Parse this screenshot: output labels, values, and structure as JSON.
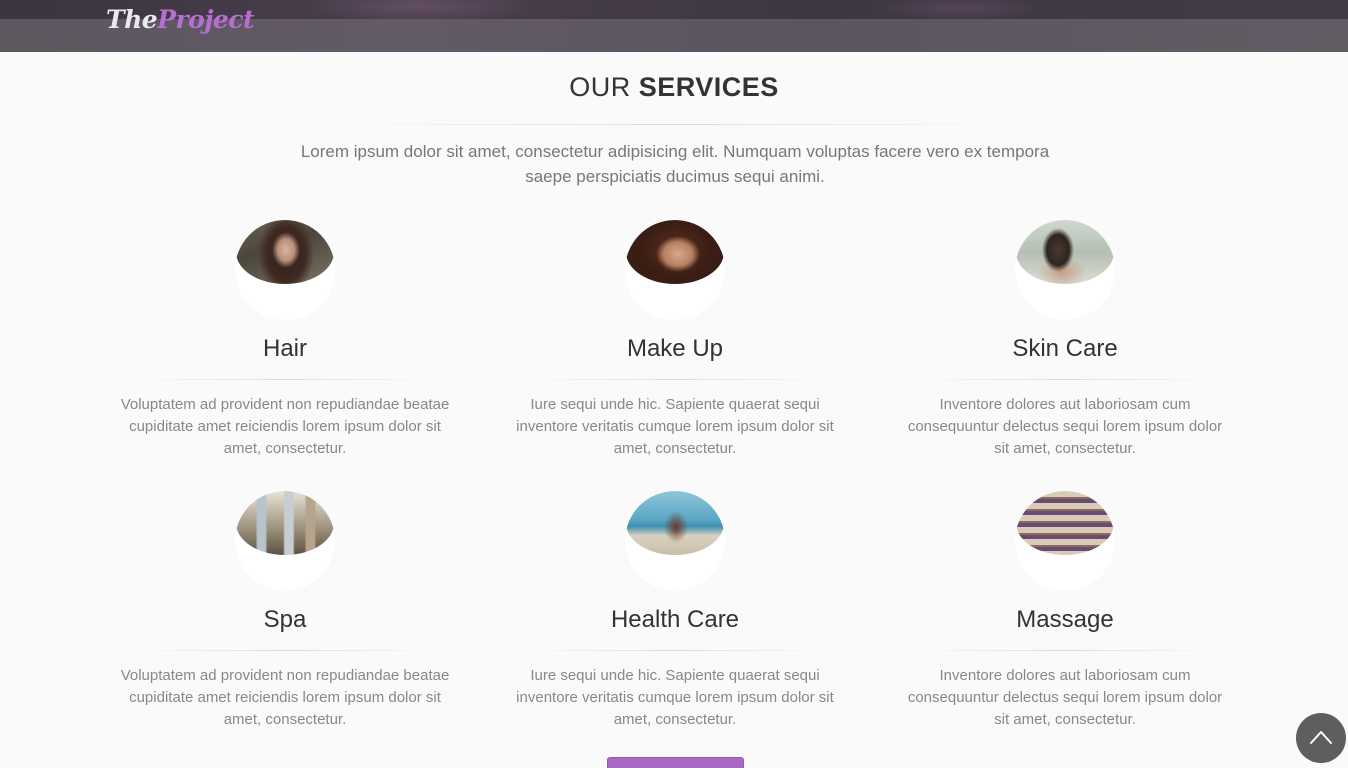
{
  "header": {
    "logo_part1": "The",
    "logo_part2": "Project"
  },
  "section": {
    "title_light": "OUR",
    "title_bold": "SERVICES",
    "lead": "Lorem ipsum dolor sit amet, consectetur adipisicing elit. Numquam voluptas facere vero ex tempora saepe perspiciatis ducimus sequi animi."
  },
  "services": [
    {
      "name": "Hair",
      "image": "woman-portrait-hair-photo",
      "desc": "Voluptatem ad provident non repudiandae beatae cupiditate amet reiciendis lorem ipsum dolor sit amet, consectetur."
    },
    {
      "name": "Make Up",
      "image": "woman-face-makeup-photo",
      "desc": "Iure sequi unde hic. Sapiente quaerat sequi inventore veritatis cumque lorem ipsum dolor sit amet, consectetur."
    },
    {
      "name": "Skin Care",
      "image": "woman-skin-care-photo",
      "desc": "Inventore dolores aut laboriosam cum consequuntur delectus sequi lorem ipsum dolor sit amet, consectetur."
    },
    {
      "name": "Spa",
      "image": "spa-interior-photo",
      "desc": "Voluptatem ad provident non repudiandae beatae cupiditate amet reiciendis lorem ipsum dolor sit amet, consectetur."
    },
    {
      "name": "Health Care",
      "image": "yoga-beach-photo",
      "desc": "Iure sequi unde hic. Sapiente quaerat sequi inventore veritatis cumque lorem ipsum dolor sit amet, consectetur."
    },
    {
      "name": "Massage",
      "image": "folded-towels-photo",
      "desc": "Inventore dolores aut laboriosam cum consequuntur delectus sequi lorem ipsum dolor sit amet, consectetur."
    }
  ],
  "colors": {
    "accent": "#a869c3",
    "header_bg": "#5d5760",
    "heading": "#333333",
    "body_text": "#888888"
  },
  "icons": {
    "back_to_top": "chevron-up-icon"
  }
}
